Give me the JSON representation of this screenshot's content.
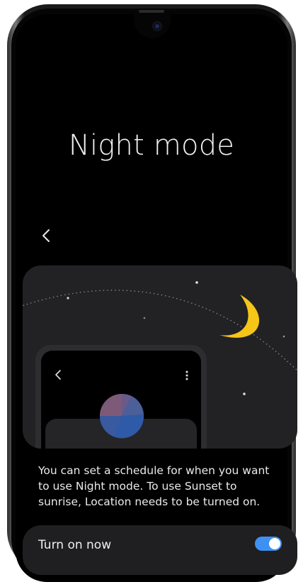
{
  "screen": {
    "title": "Night mode",
    "description": "You can set a schedule for when you want to use Night mode. To use Sunset to sunrise, Location needs to be turned on.",
    "turn_on_now": {
      "label": "Turn on now",
      "state": "on"
    }
  },
  "icons": {
    "back": "back-chevron-icon",
    "moon": "moon-icon",
    "more": "more-vert-icon"
  },
  "colors": {
    "toggle_on": "#3e91f2",
    "moon": "#f5c518",
    "background": "#000000",
    "card": "#222224"
  }
}
